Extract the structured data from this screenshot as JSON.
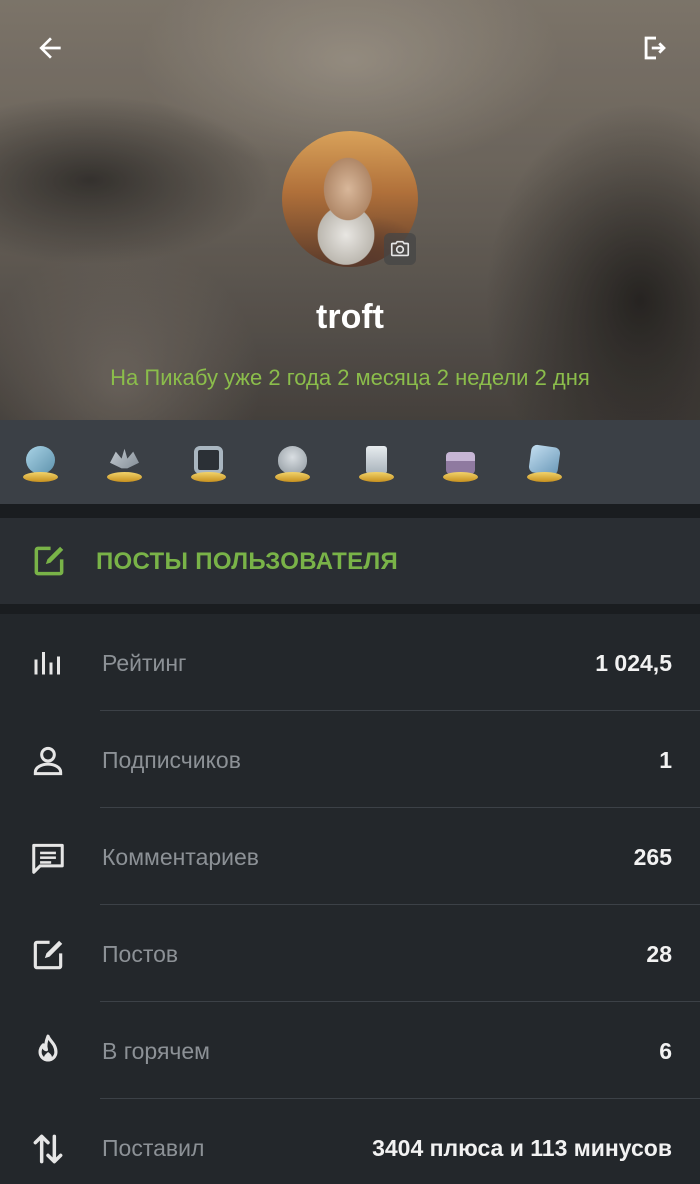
{
  "header": {
    "username": "troft",
    "tenure": "На Пикабу уже 2 года 2 месяца 2 недели 2 дня",
    "back_icon": "arrow-left-icon",
    "logout_icon": "logout-icon",
    "camera_icon": "camera-icon"
  },
  "awards": [
    {
      "name": "award-video",
      "color": "#7fb2c9"
    },
    {
      "name": "award-bat",
      "color": "#9aa3ab"
    },
    {
      "name": "award-frame",
      "color": "#6f7a85"
    },
    {
      "name": "award-alien",
      "color": "#a9b1b8"
    },
    {
      "name": "award-document",
      "color": "#b7c1c9"
    },
    {
      "name": "award-cake",
      "color": "#b9a8c6"
    },
    {
      "name": "award-cube",
      "color": "#8fb6cf"
    }
  ],
  "posts_link": {
    "label": "ПОСТЫ ПОЛЬЗОВАТЕЛЯ",
    "icon": "edit-icon"
  },
  "stats": [
    {
      "icon": "bar-chart-icon",
      "label": "Рейтинг",
      "value": "1 024,5"
    },
    {
      "icon": "user-icon",
      "label": "Подписчиков",
      "value": "1"
    },
    {
      "icon": "comment-icon",
      "label": "Комментариев",
      "value": "265"
    },
    {
      "icon": "edit-icon",
      "label": "Постов",
      "value": "28"
    },
    {
      "icon": "flame-icon",
      "label": "В горячем",
      "value": "6"
    },
    {
      "icon": "sort-arrows-icon",
      "label": "Поставил",
      "value": "3404 плюса и 113 минусов"
    }
  ],
  "colors": {
    "accent_green": "#79b348",
    "tenure_green": "#8bbd4b",
    "background": "#22262a"
  }
}
